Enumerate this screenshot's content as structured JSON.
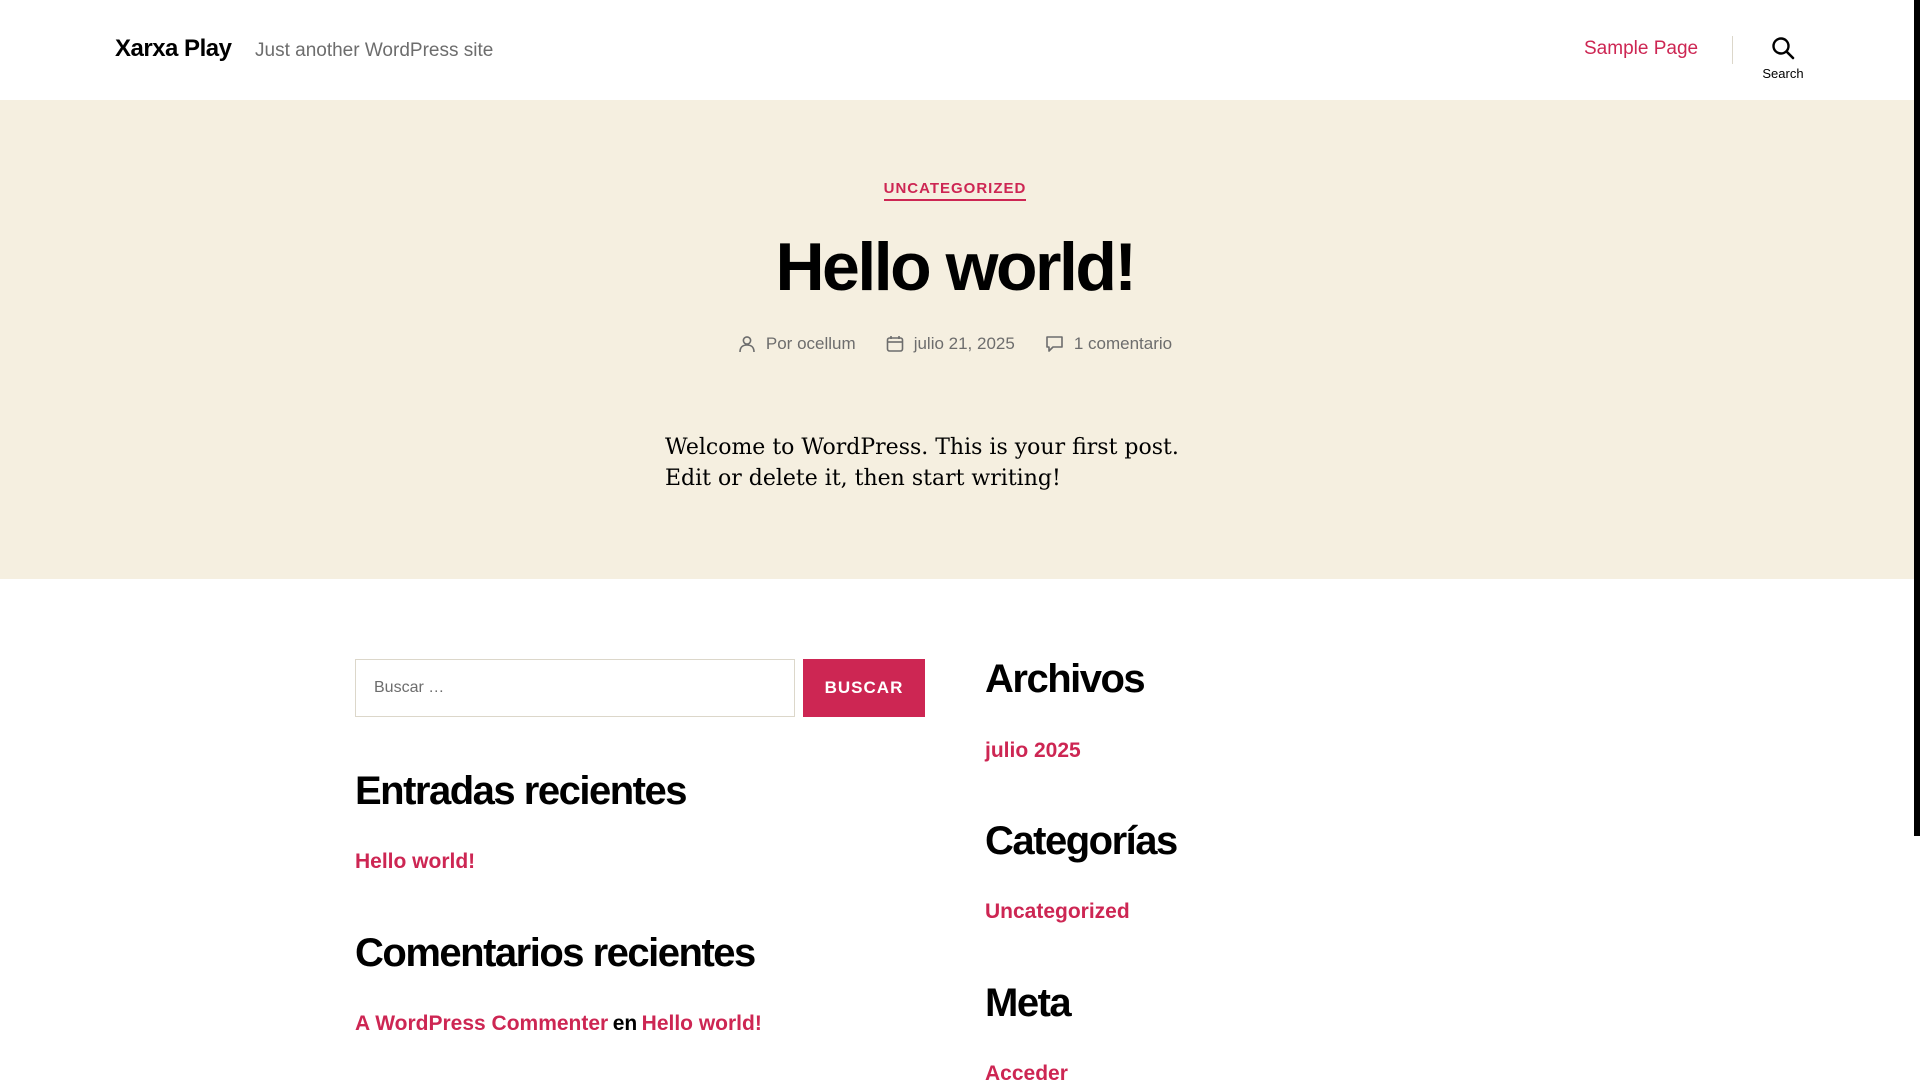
{
  "header": {
    "site_title": "Xarxa Play",
    "tagline": "Just another WordPress site",
    "nav_sample": "Sample Page",
    "search_label": "Search"
  },
  "post": {
    "category": "UNCATEGORIZED",
    "title": "Hello world!",
    "meta": {
      "author_prefix": "Por",
      "author": "ocellum",
      "date": "julio 21, 2025",
      "comments": "1 comentario"
    },
    "body": "Welcome to WordPress. This is your first post. Edit or delete it, then start writing!"
  },
  "widgets": {
    "search": {
      "placeholder": "Buscar …",
      "button": "BUSCAR"
    },
    "recent_posts": {
      "title": "Entradas recientes",
      "items": [
        "Hello world!"
      ]
    },
    "recent_comments": {
      "title": "Comentarios recientes",
      "author": "A WordPress Commenter",
      "connector": "en",
      "post": "Hello world!"
    },
    "archives": {
      "title": "Archivos",
      "items": [
        "julio 2025"
      ]
    },
    "categories": {
      "title": "Categorías",
      "items": [
        "Uncategorized"
      ]
    },
    "meta": {
      "title": "Meta",
      "items": [
        "Acceder"
      ]
    }
  },
  "colors": {
    "accent": "#cd2653",
    "hero_bg": "#f5efe0",
    "muted_text": "#6d6d6d"
  }
}
